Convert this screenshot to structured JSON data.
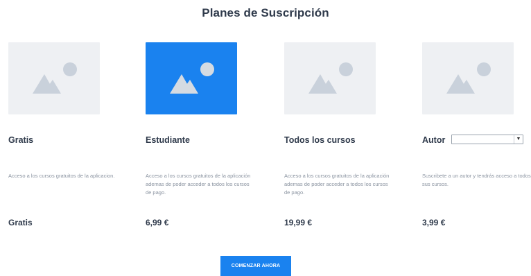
{
  "page": {
    "title": "Planes de Suscripción"
  },
  "colors": {
    "accent": "#1a82ef",
    "placeholder": "#eef0f3",
    "text": "#2f3a4b",
    "muted": "#8a93a0"
  },
  "plans": [
    {
      "name": "Gratis",
      "description": "Acceso a los cursos gratuitos de la aplicacion.",
      "price": "Gratis",
      "icon": "image-placeholder-icon"
    },
    {
      "name": "Estudiante",
      "description": "Acceso a los cursos gratuitos de la aplicación ademas de poder acceder a todos los cursos de pago.",
      "price": "6,99 €",
      "icon": "image-placeholder-icon",
      "selected": true
    },
    {
      "name": "Todos los cursos",
      "description": "Acceso a los cursos gratuitos de la aplicación ademas de poder acceder a todos los cursos de pago.",
      "price": "19,99 €",
      "icon": "image-placeholder-icon"
    },
    {
      "name": "Autor",
      "description": "Suscribete a un autor y tendrás acceso a todos sus cursos.",
      "price": "3,99 €",
      "icon": "image-placeholder-icon"
    }
  ],
  "author_select": {
    "value": "",
    "icon": "dropdown-arrow-icon"
  },
  "cta": {
    "label": "COMENZAR AHORA"
  }
}
